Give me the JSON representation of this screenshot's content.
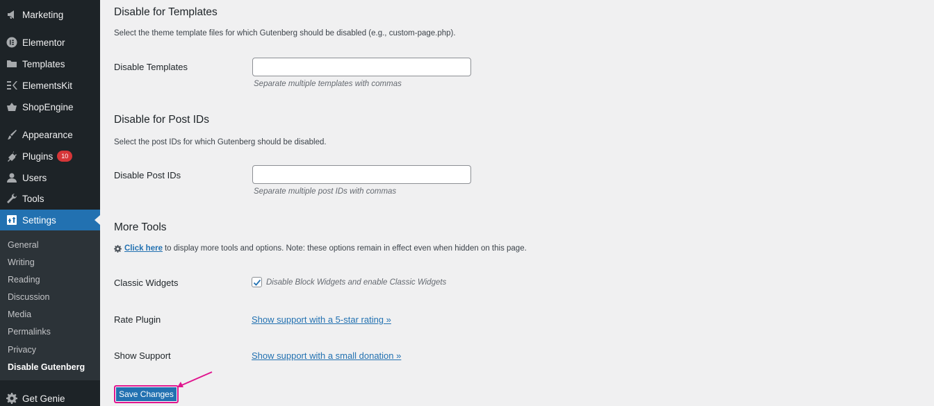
{
  "sidebar": {
    "items": [
      {
        "label": "Marketing",
        "icon": "megaphone-icon"
      },
      {
        "label": "Elementor",
        "icon": "elementor-icon"
      },
      {
        "label": "Templates",
        "icon": "folder-icon"
      },
      {
        "label": "ElementsKit",
        "icon": "elementskit-icon"
      },
      {
        "label": "ShopEngine",
        "icon": "basket-icon"
      },
      {
        "label": "Appearance",
        "icon": "paintbrush-icon"
      },
      {
        "label": "Plugins",
        "icon": "plugin-icon",
        "badge": "10"
      },
      {
        "label": "Users",
        "icon": "user-icon"
      },
      {
        "label": "Tools",
        "icon": "wrench-icon"
      },
      {
        "label": "Settings",
        "icon": "settings-icon"
      },
      {
        "label": "Get Genie",
        "icon": "gear-icon"
      }
    ],
    "submenu": [
      "General",
      "Writing",
      "Reading",
      "Discussion",
      "Media",
      "Permalinks",
      "Privacy",
      "Disable Gutenberg"
    ]
  },
  "templates_section": {
    "heading": "Disable for Templates",
    "description": "Select the theme template files for which Gutenberg should be disabled (e.g., custom-page.php).",
    "field_label": "Disable Templates",
    "field_value": "",
    "hint": "Separate multiple templates with commas"
  },
  "postids_section": {
    "heading": "Disable for Post IDs",
    "description": "Select the post IDs for which Gutenberg should be disabled.",
    "field_label": "Disable Post IDs",
    "field_value": "",
    "hint": "Separate multiple post IDs with commas"
  },
  "more_tools": {
    "heading": "More Tools",
    "click_link": "Click here",
    "note": "to display more tools and options. Note: these options remain in effect even when hidden on this page.",
    "classic_widgets_label": "Classic Widgets",
    "classic_widgets_checkbox": "Disable Block Widgets and enable Classic Widgets",
    "classic_widgets_checked": true,
    "rate_label": "Rate Plugin",
    "rate_link": "Show support with a 5-star rating »",
    "support_label": "Show Support",
    "support_link": "Show support with a small donation »"
  },
  "save_button": "Save Changes",
  "colors": {
    "sidebar_bg": "#1d2327",
    "accent": "#2271b1",
    "badge": "#d63638",
    "highlight": "#e0158e"
  }
}
